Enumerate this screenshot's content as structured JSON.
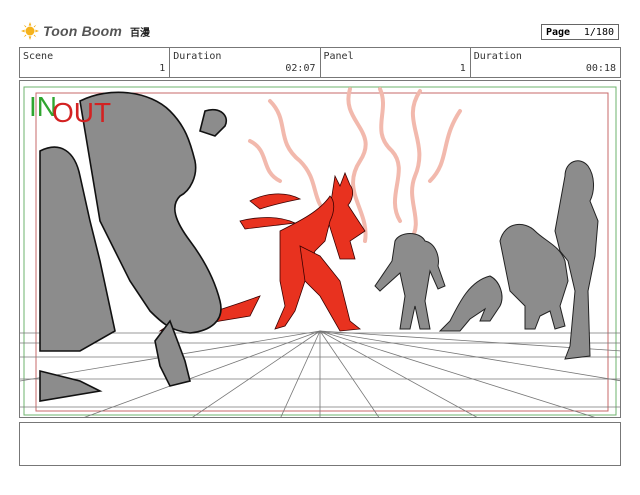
{
  "header": {
    "brand": "Toon Boom",
    "project": "百漫",
    "logo_icon": "toon-boom-sun-icon"
  },
  "page": {
    "label": "Page",
    "value": "1/180"
  },
  "info": {
    "scene_label": "Scene",
    "scene_value": "1",
    "scene_duration_label": "Duration",
    "scene_duration_value": "02:07",
    "panel_label": "Panel",
    "panel_value": "1",
    "panel_duration_label": "Duration",
    "panel_duration_value": "00:18"
  },
  "panel_marks": {
    "in": "IN",
    "out": "OUT"
  },
  "colors": {
    "in_marker": "#2fa52f",
    "out_marker": "#d32222",
    "red_character": "#e8321f",
    "grey_character": "#8c8c8c",
    "lightning": "#f2b9ad"
  },
  "notes": {
    "text": ""
  }
}
